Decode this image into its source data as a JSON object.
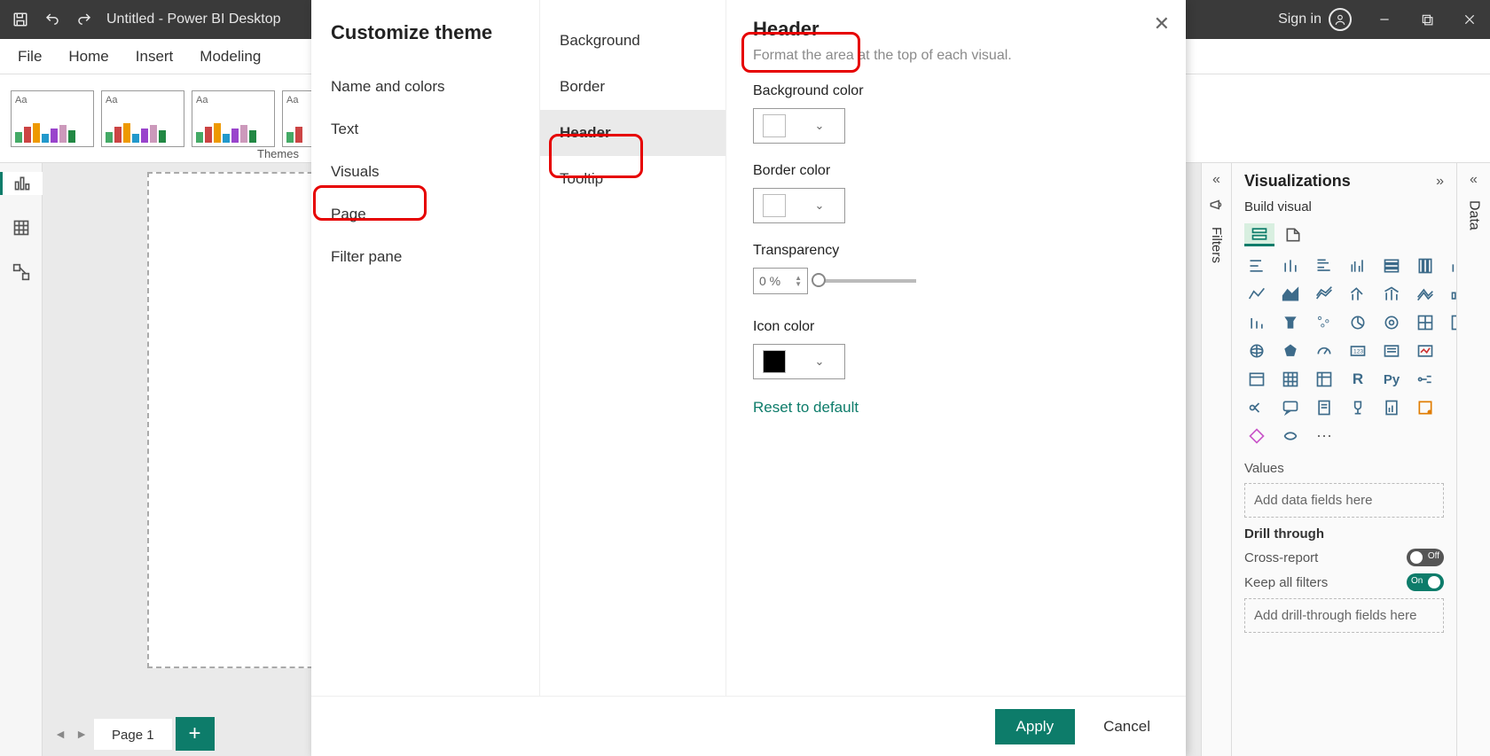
{
  "titlebar": {
    "title": "Untitled - Power BI Desktop",
    "signin": "Sign in"
  },
  "ribbon": {
    "tabs": [
      "File",
      "Home",
      "Insert",
      "Modeling"
    ]
  },
  "themes_label": "Themes",
  "page_tab": "Page 1",
  "collapse_right_label": "ᐱ",
  "filters": {
    "label": "Filters"
  },
  "data": {
    "label": "Data"
  },
  "viz": {
    "title": "Visualizations",
    "subtitle": "Build visual",
    "values_label": "Values",
    "values_placeholder": "Add data fields here",
    "drill_label": "Drill through",
    "cross_report": "Cross-report",
    "keep_filters": "Keep all filters",
    "drill_placeholder": "Add drill-through fields here",
    "off": "Off",
    "on": "On"
  },
  "dialog": {
    "title": "Customize theme",
    "col1": [
      "Name and colors",
      "Text",
      "Visuals",
      "Page",
      "Filter pane"
    ],
    "col2": [
      "Background",
      "Border",
      "Header",
      "Tooltip"
    ],
    "header": {
      "title": "Header",
      "desc": "Format the area at the top of each visual.",
      "bg_label": "Background color",
      "border_label": "Border color",
      "transparency_label": "Transparency",
      "transparency_value": "0 %",
      "icon_label": "Icon color",
      "reset": "Reset to default"
    },
    "apply": "Apply",
    "cancel": "Cancel"
  }
}
